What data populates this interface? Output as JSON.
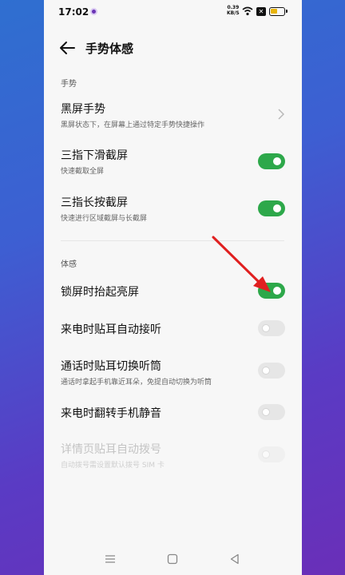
{
  "status": {
    "time": "17:02",
    "speed_value": "0.39",
    "speed_unit": "KB/S"
  },
  "header": {
    "title": "手势体感"
  },
  "sections": {
    "gesture": "手势",
    "motion": "体感"
  },
  "rows": [
    {
      "label": "黑屏手势",
      "sub": "黑屏状态下，在屏幕上通过特定手势快捷操作",
      "control": "chevron"
    },
    {
      "label": "三指下滑截屏",
      "sub": "快速截取全屏",
      "control": "toggle",
      "state": "on"
    },
    {
      "label": "三指长按截屏",
      "sub": "快速进行区域截屏与长截屏",
      "control": "toggle",
      "state": "on"
    },
    {
      "label": "锁屏时抬起亮屏",
      "sub": "",
      "control": "toggle",
      "state": "on"
    },
    {
      "label": "来电时贴耳自动接听",
      "sub": "",
      "control": "toggle",
      "state": "off"
    },
    {
      "label": "通话时贴耳切换听筒",
      "sub": "通话时拿起手机靠近耳朵，免提自动切换为听筒",
      "control": "toggle",
      "state": "off"
    },
    {
      "label": "来电时翻转手机静音",
      "sub": "",
      "control": "toggle",
      "state": "off"
    },
    {
      "label": "详情页贴耳自动拨号",
      "sub": "自动拨号需设置默认拨号 SIM 卡",
      "control": "toggle",
      "state": "disabled"
    }
  ],
  "colors": {
    "toggle_on": "#2da84a",
    "annotation_arrow": "#e02020",
    "battery": "#e8b40a"
  },
  "icons": {
    "back": "back-arrow-icon",
    "menu": "menu-icon",
    "home": "home-icon",
    "back_nav": "back-triangle-icon"
  }
}
